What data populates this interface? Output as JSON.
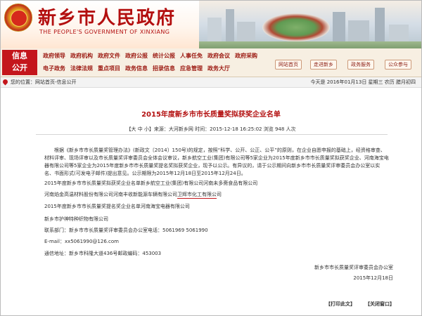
{
  "header": {
    "title": "新乡市人民政府",
    "subtitle": "THE PEOPLE'S GOVERNMENT OF XINXIANG"
  },
  "nav": {
    "label_line1": "信息",
    "label_line2": "公开",
    "row1": [
      "政府领导",
      "政府机构",
      "政府文件",
      "政府公报",
      "统计公报",
      "人事任免",
      "政府会议",
      "政府采购"
    ],
    "row2": [
      "电子政务",
      "法律法规",
      "重点项目",
      "政务信息",
      "招录信息",
      "应急管理",
      "政务大厅"
    ],
    "buttons": [
      "网站首页",
      "走进新乡",
      "政务服务",
      "公众参与"
    ]
  },
  "location": {
    "text": "您的位置：网站首页-信息公开",
    "date": "今天是 2016年01月13日 星期三 农历 腊月初四"
  },
  "article": {
    "title": "2015年度新乡市市长质量奖拟获奖企业名单",
    "meta": "【大 中 小】来源：大河新乡网   时间：2015-12-18 16:25:02  浏览 948 人次",
    "para1": "根据《新乡市市长质量奖管理办法》(新政文〔2014〕150号)的规定，按照“科学、公开、公正、公平”的原则，在企业自愿申报的基础上，经资格审查、材料评审、现场评审以及市长质量奖评审委员会全体会议审议，新乡航空工业(集团)有限公司等5家企业为2015年度新乡市市长质量奖拟获奖企业、河南海宝电器有限公司等5家企业为2015年度新乡市市长质量奖提名奖拟获奖企业，现予以公示。有异议的，请于公示期间向新乡市市长质量奖评审委员会办公室以实名、书面形式(可发电子邮件)提出意见。公示期限为2015年12月18日至2015年12月24日。",
    "line1": "2015年度新乡市市长质量奖拟获奖企业名单新乡航空工业(集团)有限公司河南未多斋食品有限公司",
    "line2": "河南焰金高温材料股份有限公司河南丰收新能源车辆有限公司卫辉市化工有限公司",
    "line3": "2015年度新乡市市长质量奖提名奖企业名单河南海宝电器有限公司",
    "line4": "新乡市护神特种织物有限公司",
    "line5": "联系部门：新乡市市长质量奖评审委员会办公室电话：5061969 5061990",
    "line6": "E-mail：xx5061990@126.com",
    "line7": "通信地址：新乡市科隆大道436号邮政编码：453003",
    "sign_org": "新乡市市长质量奖评审委员会办公室",
    "sign_date": "2015年12月18日"
  },
  "footer": {
    "print": "【打印此文】",
    "close": "【关闭窗口】"
  },
  "colors": {
    "brand_red": "#b30f0f",
    "nav_bg": "#f7efe2"
  }
}
